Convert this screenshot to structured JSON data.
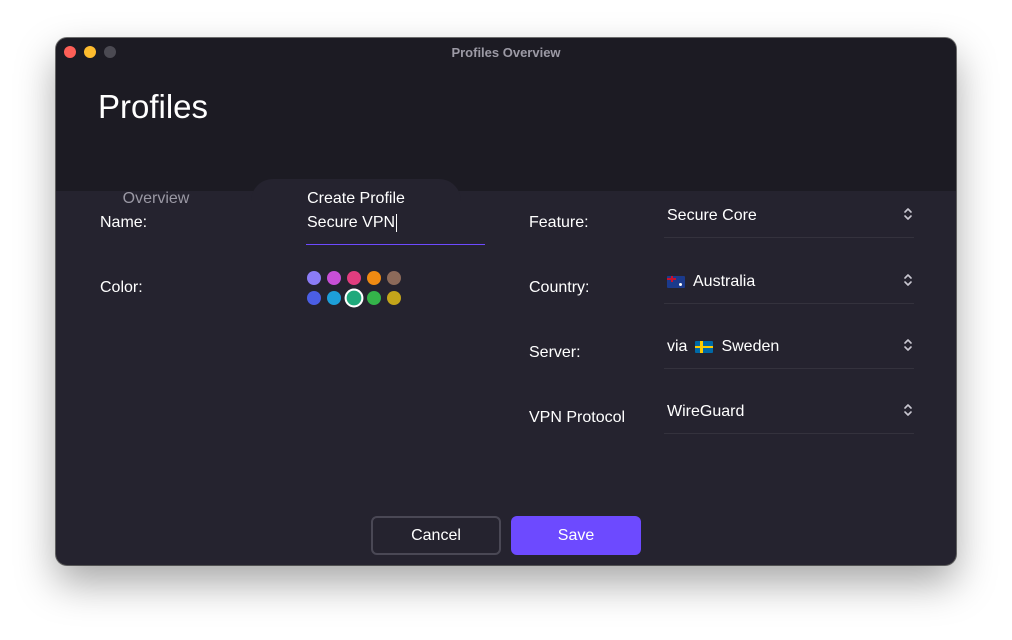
{
  "window": {
    "title": "Profiles Overview"
  },
  "header": {
    "title": "Profiles"
  },
  "tabs": [
    {
      "label": "Overview",
      "active": false
    },
    {
      "label": "Create Profile",
      "active": true
    }
  ],
  "form": {
    "name_label": "Name:",
    "name_value": "Secure VPN",
    "color_label": "Color:",
    "colors": [
      "#8b7cf6",
      "#c84fd6",
      "#e23d7f",
      "#ef8a12",
      "#8c6a5a",
      "#4b5ee4",
      "#1d9fd9",
      "#1fa97b",
      "#34b44a",
      "#c4a51a"
    ],
    "selected_color": "#1fa97b",
    "feature_label": "Feature:",
    "feature_value": "Secure Core",
    "country_label": "Country:",
    "country_value": "Australia",
    "server_label": "Server:",
    "server_prefix": "via",
    "server_value": "Sweden",
    "protocol_label": "VPN Protocol",
    "protocol_value": "WireGuard"
  },
  "buttons": {
    "cancel": "Cancel",
    "save": "Save"
  },
  "accent": "#6d4aff"
}
